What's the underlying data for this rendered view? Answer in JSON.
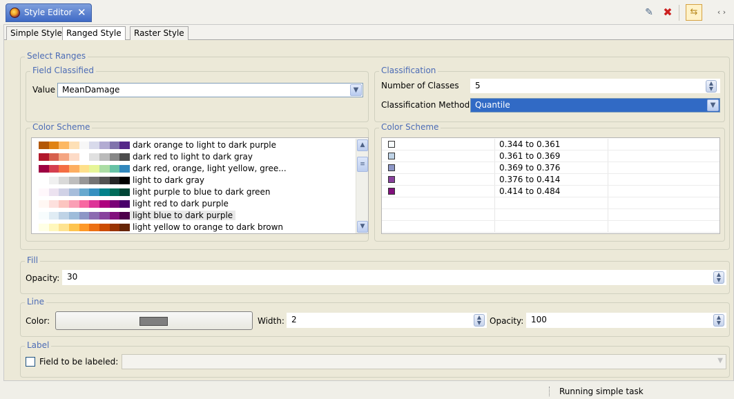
{
  "view": {
    "tab_title": "Style Editor",
    "close_glyph": "✕",
    "toolbar_icons": [
      "import-style-icon",
      "delete-style-icon",
      "apply-style-icon",
      "view-menu-icon"
    ],
    "views_label": "‹ ›"
  },
  "tabs": [
    "Simple Style",
    "Ranged Style",
    "Raster Style"
  ],
  "select_ranges": {
    "title": "Select Ranges",
    "field_classified": {
      "title": "Field Classified",
      "value_label": "Value",
      "value": "MeanDamage"
    },
    "classification": {
      "title": "Classification",
      "num_classes_label": "Number of Classes",
      "num_classes": "5",
      "method_label": "Classification Method",
      "method": "Quantile"
    },
    "color_scheme_left": {
      "title": "Color Scheme",
      "items": [
        {
          "label": "dark orange to light to dark purple",
          "colors": [
            "#b35806",
            "#e08214",
            "#fdb863",
            "#fee0b6",
            "#f7f7f7",
            "#d8daeb",
            "#b2abd2",
            "#8073ac",
            "#542788"
          ]
        },
        {
          "label": "dark red to light to dark gray",
          "colors": [
            "#b2182b",
            "#d6604d",
            "#f4a582",
            "#fddbc7",
            "#ffffff",
            "#e0e0e0",
            "#bababa",
            "#878787",
            "#4d4d4d"
          ]
        },
        {
          "label": "dark red, orange, light yellow, gree...",
          "colors": [
            "#9e0142",
            "#d53e4f",
            "#f46d43",
            "#fdae61",
            "#fee08b",
            "#e6f598",
            "#abdda4",
            "#66c2a5",
            "#3288bd"
          ]
        },
        {
          "label": "light to dark gray",
          "colors": [
            "#ffffff",
            "#f0f0f0",
            "#d9d9d9",
            "#bdbdbd",
            "#969696",
            "#737373",
            "#525252",
            "#252525",
            "#000000"
          ]
        },
        {
          "label": "light purple to blue to dark green",
          "colors": [
            "#fff7fb",
            "#ece2f0",
            "#d0d1e6",
            "#a6bddb",
            "#67a9cf",
            "#3690c0",
            "#02818a",
            "#016c59",
            "#014636"
          ]
        },
        {
          "label": "light red to dark purple",
          "colors": [
            "#fff7f3",
            "#fde0dd",
            "#fcc5c0",
            "#fa9fb5",
            "#f768a1",
            "#dd3497",
            "#ae017e",
            "#7a0177",
            "#49006a"
          ]
        },
        {
          "label": "light blue to dark purple",
          "colors": [
            "#f7fcfd",
            "#e0ecf4",
            "#bfd3e6",
            "#9ebcda",
            "#8c96c6",
            "#8c6bb1",
            "#88419d",
            "#810f7c",
            "#4d004b"
          ]
        },
        {
          "label": "light yellow to orange to dark brown",
          "colors": [
            "#ffffe5",
            "#fff7bc",
            "#fee391",
            "#fec44f",
            "#fe9929",
            "#ec7014",
            "#cc4c02",
            "#993404",
            "#662506"
          ]
        }
      ],
      "selected_index": 6
    },
    "color_scheme_right": {
      "title": "Color Scheme",
      "classes": [
        {
          "color": "#f7fcfd",
          "range": "0.344 to 0.361"
        },
        {
          "color": "#bfd3e6",
          "range": "0.361 to 0.369"
        },
        {
          "color": "#8c96c6",
          "range": "0.369 to 0.376"
        },
        {
          "color": "#88419d",
          "range": "0.376 to 0.414"
        },
        {
          "color": "#810f7c",
          "range": "0.414 to 0.484"
        }
      ]
    }
  },
  "fill": {
    "title": "Fill",
    "opacity_label": "Opacity:",
    "opacity": "30"
  },
  "line": {
    "title": "Line",
    "color_label": "Color:",
    "color_value": "#7f7f7f",
    "width_label": "Width:",
    "width": "2",
    "opacity_label": "Opacity:",
    "opacity": "100"
  },
  "label": {
    "title": "Label",
    "field_label": "Field to be labeled:",
    "checked": false
  },
  "status": {
    "text": "Running simple task"
  }
}
